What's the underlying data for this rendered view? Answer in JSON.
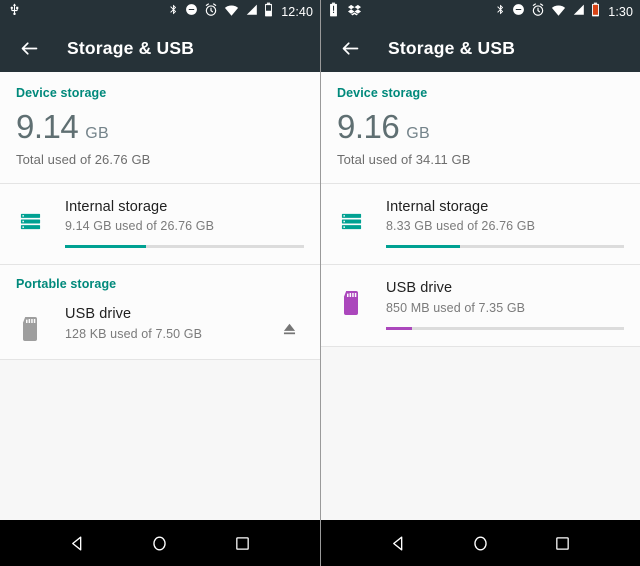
{
  "panels": [
    {
      "id": "left",
      "statusbar": {
        "left_icons": [
          "usb-icon"
        ],
        "right_icons": [
          "bluetooth-icon",
          "do-not-disturb-icon",
          "alarm-icon",
          "wifi-icon",
          "signal-icon",
          "battery-icon"
        ],
        "clock": "12:40"
      },
      "toolbar": {
        "title": "Storage & USB",
        "back_icon": "back-arrow-icon"
      },
      "device_section": {
        "label": "Device storage",
        "value": "9.14",
        "unit": "GB",
        "subtitle": "Total used of 26.76 GB"
      },
      "internal": {
        "icon": "internal-storage-icon",
        "title": "Internal storage",
        "subtitle": "9.14 GB used of 26.76 GB",
        "progress_percent": 34,
        "color": "#00a192"
      },
      "portable_section": {
        "label": "Portable storage"
      },
      "usb": {
        "icon": "sd-card-icon",
        "title": "USB drive",
        "subtitle": "128 KB used of 7.50 GB",
        "progress_percent": 0,
        "color": "#9e9e9e",
        "show_progress": false,
        "show_eject": true,
        "eject_icon": "eject-icon"
      },
      "navbar": {
        "back": "nav-back-icon",
        "home": "nav-home-icon",
        "recents": "nav-recents-icon"
      }
    },
    {
      "id": "right",
      "statusbar": {
        "left_icons": [
          "battery-alert-icon",
          "dropbox-icon"
        ],
        "right_icons": [
          "bluetooth-icon",
          "do-not-disturb-icon",
          "alarm-icon",
          "wifi-icon",
          "signal-icon",
          "battery-low-icon"
        ],
        "clock": "1:30"
      },
      "toolbar": {
        "title": "Storage & USB",
        "back_icon": "back-arrow-icon"
      },
      "device_section": {
        "label": "Device storage",
        "value": "9.16",
        "unit": "GB",
        "subtitle": "Total used of 34.11 GB"
      },
      "internal": {
        "icon": "internal-storage-icon",
        "title": "Internal storage",
        "subtitle": "8.33 GB used of 26.76 GB",
        "progress_percent": 31,
        "color": "#00a192"
      },
      "portable_section": {
        "label": ""
      },
      "usb": {
        "icon": "sd-card-icon",
        "title": "USB drive",
        "subtitle": "850 MB used of 7.35 GB",
        "progress_percent": 11,
        "color": "#ab47bc",
        "show_progress": true,
        "show_eject": false,
        "eject_icon": "eject-icon"
      },
      "navbar": {
        "back": "nav-back-icon",
        "home": "nav-home-icon",
        "recents": "nav-recents-icon"
      }
    }
  ],
  "colors": {
    "accent_teal": "#00897b",
    "statusbar_bg": "#263238",
    "progress_teal": "#00a192",
    "progress_purple": "#ab47bc",
    "sd_purple": "#ab47bc",
    "sd_gray": "#9e9e9e"
  }
}
